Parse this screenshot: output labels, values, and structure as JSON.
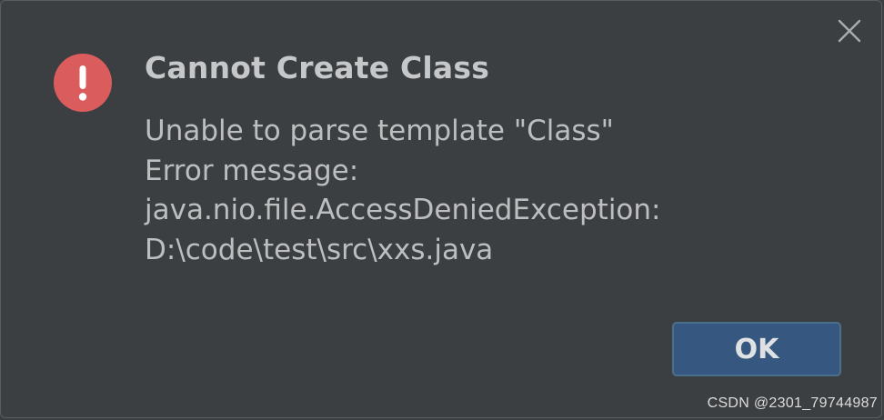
{
  "dialog": {
    "title": "Cannot Create Class",
    "icon": "error-exclamation-icon",
    "message_lines": [
      "Unable to parse template \"Class\"",
      "Error message:",
      "java.nio.file.AccessDeniedException:",
      "D:\\code\\test\\src\\xxs.java"
    ],
    "ok_label": "OK",
    "close_icon": "close-icon"
  },
  "watermark": "CSDN @2301_79744987",
  "colors": {
    "background": "#3c3f41",
    "error_red": "#db5c5c",
    "ok_button": "#365880",
    "title_text": "#c5c7c9",
    "body_text": "#bcbec0"
  }
}
